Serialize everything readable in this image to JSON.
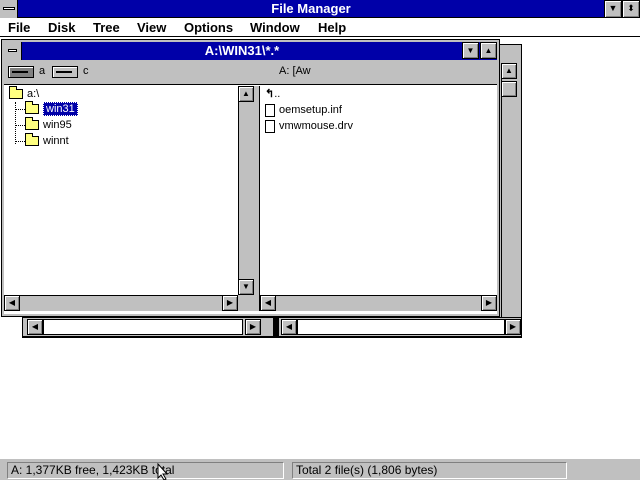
{
  "app": {
    "title": "File Manager",
    "system_menu_icon": "system-menu-icon",
    "minimize_icon": "triangle-down",
    "restore_icon": "triangle-up-down"
  },
  "menu": {
    "file": "File",
    "disk": "Disk",
    "tree": "Tree",
    "view": "View",
    "options": "Options",
    "window": "Window",
    "help": "Help"
  },
  "child_window": {
    "title": "A:\\WIN31\\*.*",
    "drives": [
      {
        "letter": "a",
        "icon": "floppy-drive-icon",
        "selected": true
      },
      {
        "letter": "c",
        "icon": "hard-drive-icon",
        "selected": false
      }
    ],
    "volume_label": "A: [Aw"
  },
  "tree": {
    "root": "a:\\",
    "folders": [
      "win31",
      "win95",
      "winnt"
    ],
    "selected": "win31"
  },
  "files": {
    "parent": "..",
    "items": [
      "oemsetup.inf",
      "vmwmouse.drv"
    ]
  },
  "status": {
    "left": "A: 1,377KB free,  1,423KB total",
    "right": "Total 2 file(s) (1,806 bytes)"
  },
  "colors": {
    "title_bar": "#0000a8",
    "face": "#c0c0c0",
    "folder": "#ffff80",
    "selection": "#0000a8"
  }
}
